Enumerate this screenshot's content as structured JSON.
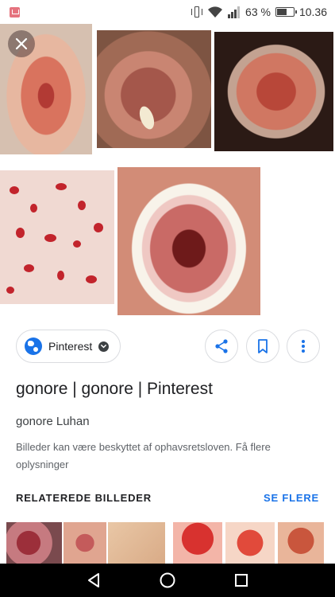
{
  "status_bar": {
    "battery_percent": "63 %",
    "time": "10.36",
    "battery_level": 0.63,
    "icons": [
      "app-notification-icon",
      "vibrate-icon",
      "wifi-icon",
      "signal-icon",
      "battery-icon"
    ]
  },
  "viewer": {
    "close_icon": "close-icon"
  },
  "source": {
    "name": "Pinterest",
    "icons": [
      "globe-icon",
      "arrow-circle-icon"
    ]
  },
  "actions": {
    "share_icon": "share-icon",
    "save_icon": "bookmark-icon",
    "more_icon": "more-vert-icon"
  },
  "result": {
    "title": "gonore | gonore | Pinterest",
    "subtitle": "gonore Luhan",
    "copyright_note": "Billeder kan være beskyttet af ophavsretsloven. Få flere oplysninger"
  },
  "related": {
    "label": "RELATEREDE BILLEDER",
    "see_more": "SE FLERE"
  },
  "nav_bar": {
    "icons": [
      "back-icon",
      "home-icon",
      "recent-apps-icon"
    ]
  },
  "colors": {
    "accent": "#1a73e8",
    "text": "#202124",
    "muted": "#5f6368",
    "border": "#dadce0"
  }
}
